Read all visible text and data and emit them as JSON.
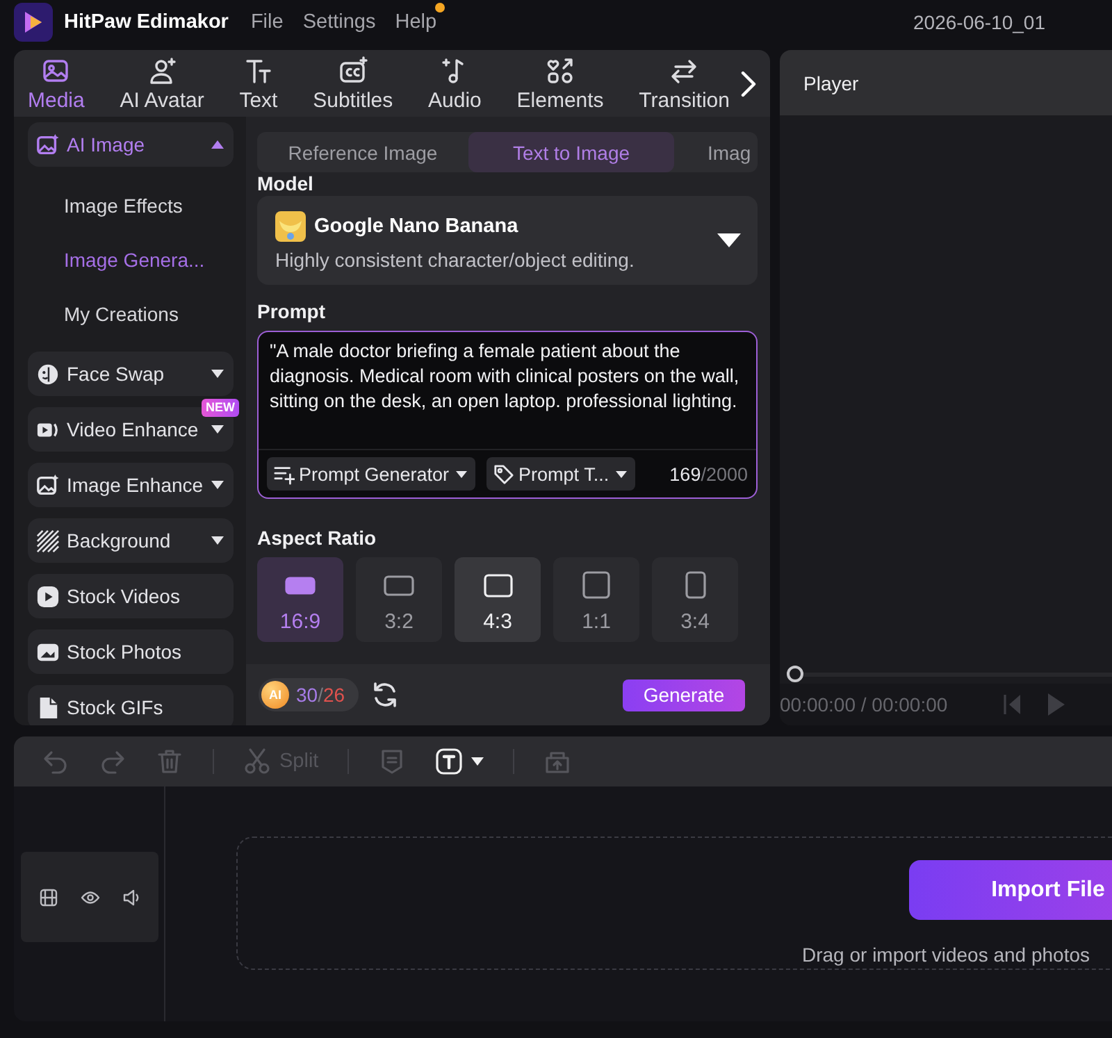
{
  "app": {
    "name": "HitPaw Edimakor",
    "menu": [
      {
        "label": "File",
        "badge": false
      },
      {
        "label": "Settings",
        "badge": false
      },
      {
        "label": "Help",
        "badge": true
      }
    ],
    "project_name": "2026-06-10_01"
  },
  "tabs": [
    {
      "label": "Media",
      "selected": true
    },
    {
      "label": "AI Avatar",
      "selected": false
    },
    {
      "label": "Text",
      "selected": false
    },
    {
      "label": "Subtitles",
      "selected": false
    },
    {
      "label": "Audio",
      "selected": false
    },
    {
      "label": "Elements",
      "selected": false
    },
    {
      "label": "Transition",
      "selected": false
    }
  ],
  "sidebar": {
    "items": [
      {
        "label": "AI Image",
        "expanded": true,
        "children": [
          {
            "label": "Image Effects",
            "selected": false
          },
          {
            "label": "Image Genera...",
            "selected": true
          },
          {
            "label": "My Creations",
            "selected": false
          }
        ]
      },
      {
        "label": "Face Swap",
        "expanded": false
      },
      {
        "label": "Video Enhance",
        "expanded": false,
        "badge": "NEW"
      },
      {
        "label": "Image Enhance",
        "expanded": false
      },
      {
        "label": "Background",
        "expanded": false
      },
      {
        "label": "Stock Videos"
      },
      {
        "label": "Stock Photos"
      },
      {
        "label": "Stock GIFs"
      }
    ]
  },
  "generator": {
    "modes": [
      {
        "label": "Reference Image",
        "selected": false
      },
      {
        "label": "Text to Image",
        "selected": true
      },
      {
        "label": "Imag",
        "selected": false
      }
    ],
    "model": {
      "label": "Model",
      "name": "Google Nano Banana",
      "description": "Highly consistent character/object editing."
    },
    "prompt": {
      "label": "Prompt",
      "value": "\"A male doctor briefing a female patient about the diagnosis. Medical room with clinical posters on the wall, sitting on the desk, an open laptop. professional lighting.",
      "tools": [
        {
          "label": "Prompt Generator"
        },
        {
          "label": "Prompt T..."
        }
      ],
      "count": "169",
      "limit": "/2000"
    },
    "aspect_ratio": {
      "label": "Aspect Ratio",
      "options": [
        {
          "label": "16:9",
          "selected": true,
          "hovered": false
        },
        {
          "label": "3:2",
          "selected": false,
          "hovered": false
        },
        {
          "label": "4:3",
          "selected": false,
          "hovered": true
        },
        {
          "label": "1:1",
          "selected": false,
          "hovered": false
        },
        {
          "label": "3:4",
          "selected": false,
          "hovered": false
        }
      ]
    },
    "credits": {
      "coin": "AI",
      "balance": "30",
      "separator": "/",
      "cost": "26"
    },
    "generate_button": "Generate"
  },
  "player": {
    "title": "Player",
    "scrubber": {
      "level": 0
    },
    "time": "00:00:00 / 00:00:00"
  },
  "timeline": {
    "toolbar": [
      {
        "disabled": true
      },
      {
        "disabled": true
      },
      {
        "disabled": true
      },
      {
        "label": "Split",
        "disabled": true
      },
      {
        "disabled": true
      },
      {
        "disabled": false,
        "menu": true
      },
      {
        "disabled": true
      }
    ],
    "drop_zone": {
      "button": "Import File",
      "hint": "Drag or import videos and photos"
    }
  }
}
